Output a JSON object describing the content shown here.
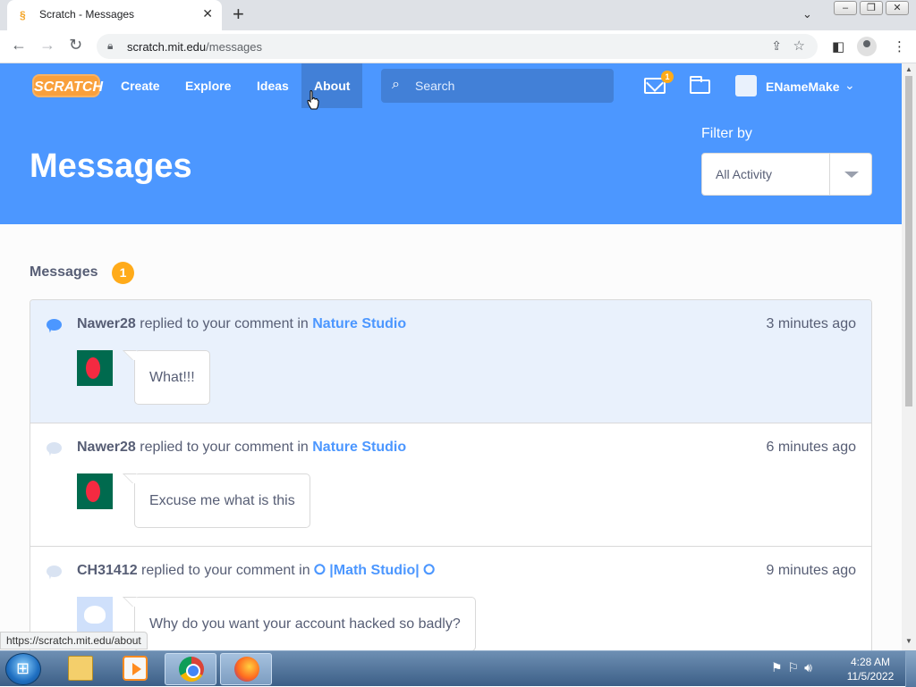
{
  "browser": {
    "tab_title": "Scratch - Messages",
    "tab_favicon": "scratch-s",
    "url_host": "scratch.mit.edu",
    "url_path": "/messages",
    "status_url": "https://scratch.mit.edu/about",
    "window_controls": [
      "minimize",
      "restore",
      "close"
    ]
  },
  "nav": {
    "logo": "SCRATCH",
    "links": [
      "Create",
      "Explore",
      "Ideas",
      "About"
    ],
    "active_link": "About",
    "search_placeholder": "Search",
    "message_count": "1",
    "username": "ENameMake"
  },
  "header": {
    "title": "Messages",
    "filter_label": "Filter by",
    "filter_value": "All Activity"
  },
  "section": {
    "title": "Messages",
    "count": "1"
  },
  "messages": [
    {
      "user": "Nawer28",
      "action": " replied to your comment in ",
      "studio": "Nature Studio",
      "time": "3 minutes ago",
      "text": "What!!!",
      "unread": true,
      "avatar": "bangladesh-flag"
    },
    {
      "user": "Nawer28",
      "action": " replied to your comment in ",
      "studio": "Nature Studio",
      "time": "6 minutes ago",
      "text": "Excuse me what is this",
      "unread": false,
      "avatar": "bangladesh-flag"
    },
    {
      "user": "CH31412",
      "action": " replied to your comment in ",
      "studio": "⭘ |Math Studio| ⭘",
      "time": "9 minutes ago",
      "text": "Why do you want your account hacked so badly?",
      "unread": false,
      "avatar": "scratch-cat"
    }
  ],
  "taskbar": {
    "clock_time": "4:28 AM",
    "clock_date": "11/5/2022",
    "apps": [
      "explorer",
      "media-player",
      "chrome",
      "firefox"
    ]
  },
  "colors": {
    "scratch_blue": "#4c97ff",
    "scratch_orange": "#ffab1a",
    "text": "#575e75"
  }
}
